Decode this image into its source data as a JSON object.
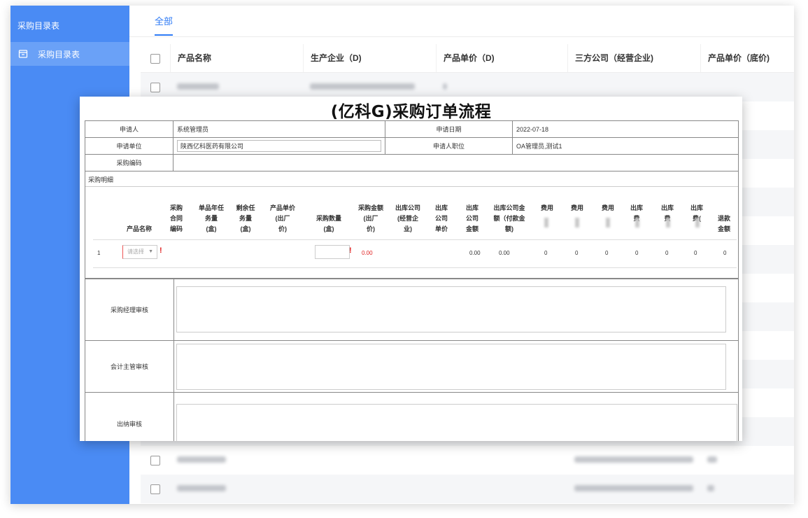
{
  "sidebar": {
    "title": "采购目录表",
    "items": [
      {
        "label": "采购目录表",
        "icon": "folder-icon"
      }
    ]
  },
  "main": {
    "tabs": [
      {
        "label": "全部"
      }
    ],
    "columns": [
      "产品名称",
      "生产企业（D)",
      "产品单价（D)",
      "三方公司（经营企业)",
      "产品单价（底价)"
    ]
  },
  "form": {
    "title": "(亿科G)采购订单流程",
    "applicant_label": "申请人",
    "applicant_value": "系统管理员",
    "apply_date_label": "申请日期",
    "apply_date_value": "2022-07-18",
    "unit_label": "申请单位",
    "unit_value": "陕西亿科医药有限公司",
    "position_label": "申请人职位",
    "position_value": "OA管理员,测试1",
    "code_label": "采购编码",
    "detail_label": "采购明细",
    "detail_headers": {
      "product_name": "产品名称",
      "contract_code": "采购\n合同\n编码",
      "annual_task": "单品年任\n务量\n(盒)",
      "remaining_task": "剩余任\n务量\n(盒)",
      "unit_price": "产品单价\n(出厂\n价)",
      "purchase_qty": "采购数量\n(盒)",
      "purchase_amount": "采购金额\n(出厂\n价)",
      "out_company": "出库公司\n(经营企\n业)",
      "out_unit_price": "出库\n公司\n单价",
      "out_amount": "出库\n公司\n金额",
      "out_payment": "出库公司金\n额（付款金\n额)",
      "fee1": "费用",
      "fee2": "费用",
      "fee3": "费用",
      "out_fee1": "出库\n费",
      "out_fee2": "出库\n费",
      "out_fee3": "出库\n费(",
      "refund": "退款\n金额"
    },
    "detail_row": {
      "index": "1",
      "select_placeholder": "请选择",
      "required_mark": "!",
      "purchase_amount": "0.00",
      "out_amount": "0.00",
      "out_payment": "0.00",
      "fee1": "0",
      "fee2": "0",
      "fee3": "0",
      "out_fee1": "0",
      "out_fee2": "0",
      "refund": "0"
    },
    "approvals": [
      "采购经理审核",
      "会计主管审核",
      "出纳审核"
    ]
  }
}
